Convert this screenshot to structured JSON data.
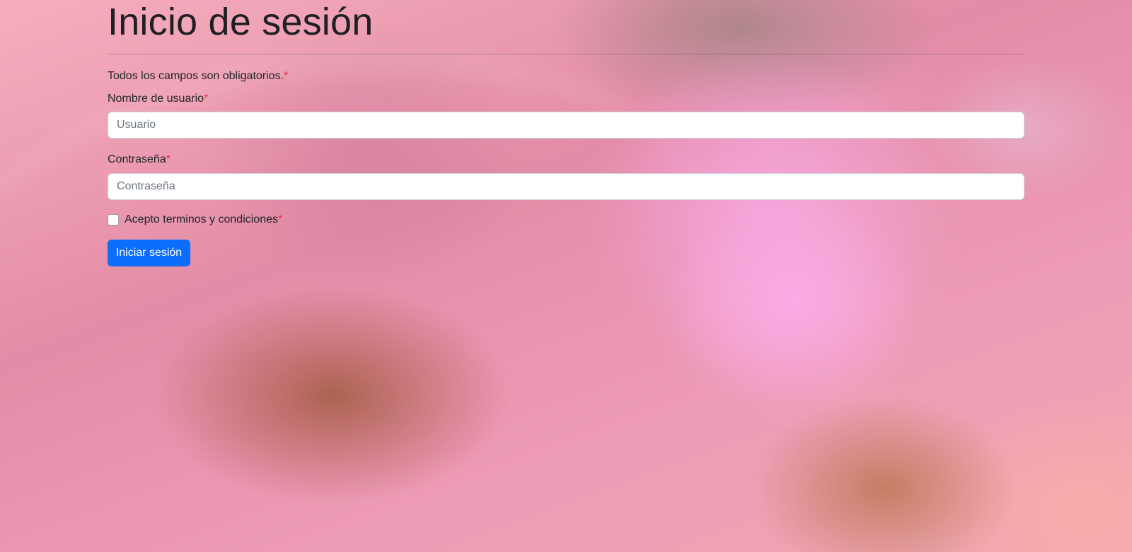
{
  "page": {
    "title": "Inicio de sesión",
    "required_note": "Todos los campos son obligatorios.",
    "required_mark": "*"
  },
  "form": {
    "username": {
      "label": "Nombre de usuario",
      "placeholder": "Usuario",
      "value": ""
    },
    "password": {
      "label": "Contraseña",
      "placeholder": "Contraseña",
      "value": ""
    },
    "terms": {
      "label": "Acepto terminos y condiciones",
      "checked": false
    },
    "submit_label": "Iniciar sesión"
  },
  "colors": {
    "text": "#212529",
    "required": "#dc3545",
    "primary_button": "#0d6efd",
    "input_background": "#ffffff",
    "input_border": "#ced4da"
  },
  "icons": {
    "checkbox": "checkbox-unchecked"
  }
}
